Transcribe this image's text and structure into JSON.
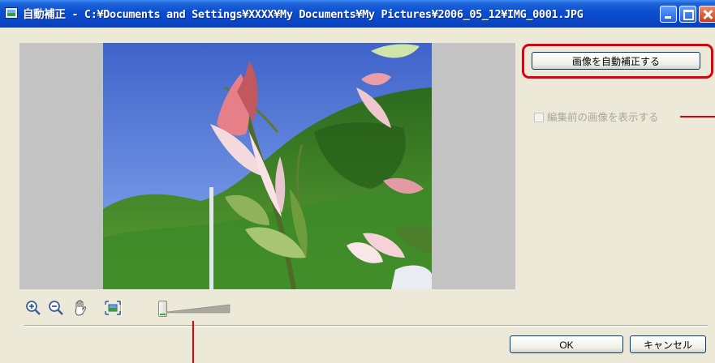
{
  "window": {
    "title": "自動補正 - C:¥Documents and Settings¥XXXX¥My Documents¥My Pictures¥2006_05_12¥IMG_0001.JPG",
    "controls": {
      "minimize": "minimize-icon",
      "maximize": "maximize-icon",
      "close": "close-icon"
    }
  },
  "preview": {
    "image": "flower-photo"
  },
  "panel": {
    "auto_correct_button": "画像を自動補正する",
    "show_original_checkbox": {
      "label": "編集前の画像を表示する",
      "checked": false,
      "enabled": false
    }
  },
  "toolbar": {
    "tools": [
      "zoom-in-icon",
      "zoom-out-icon",
      "hand-icon",
      "fit-to-window-icon"
    ],
    "zoom_slider": {
      "level": 0
    }
  },
  "footer": {
    "ok_label": "OK",
    "cancel_label": "キャンセル"
  },
  "colors": {
    "titlebar": "#0a4ed0",
    "highlight": "#e00010",
    "dialog_bg": "#ece9d8"
  }
}
